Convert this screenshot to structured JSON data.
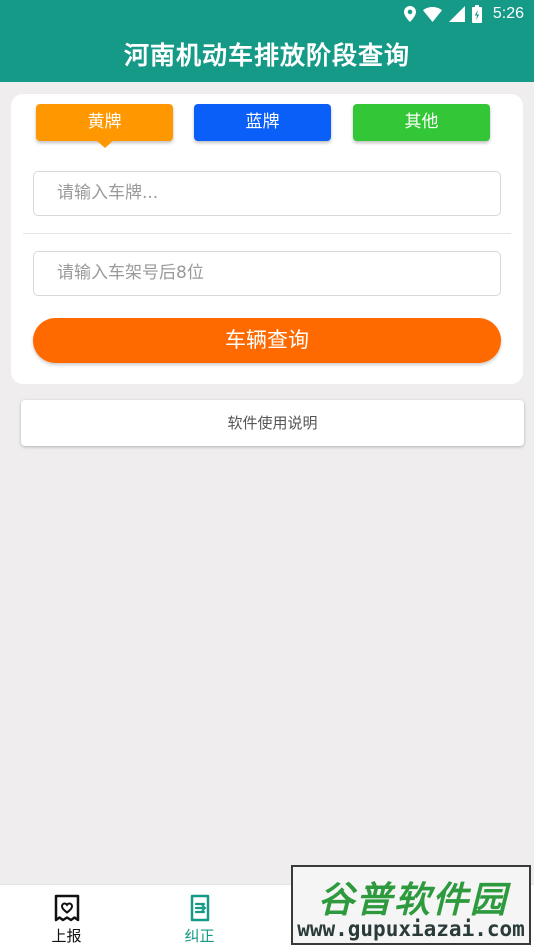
{
  "status_bar": {
    "time": "5:26"
  },
  "app_bar": {
    "title": "河南机动车排放阶段查询"
  },
  "plate_tabs": [
    {
      "label": "黄牌",
      "color": "#ff9800",
      "selected": true
    },
    {
      "label": "蓝牌",
      "color": "#0a5ff8",
      "selected": false
    },
    {
      "label": "其他",
      "color": "#33c636",
      "selected": false
    }
  ],
  "form": {
    "plate_placeholder": "请输入车牌...",
    "vin_placeholder": "请输入车架号后8位",
    "submit_label": "车辆查询",
    "submit_color": "#ff6a00"
  },
  "help": {
    "label": "软件使用说明"
  },
  "bottom_nav": [
    {
      "label": "上报",
      "icon": "receipt-icon",
      "active": false
    },
    {
      "label": "纠正",
      "icon": "document-edit-icon",
      "active": true
    },
    {
      "label": "",
      "icon": "nav-icon-3",
      "active": false
    },
    {
      "label": "",
      "icon": "nav-icon-4",
      "active": false
    }
  ],
  "watermark": {
    "name": "谷普软件园",
    "url": "www.gupuxiazai.com"
  },
  "colors": {
    "primary": "#169a88",
    "background": "#efedee"
  }
}
